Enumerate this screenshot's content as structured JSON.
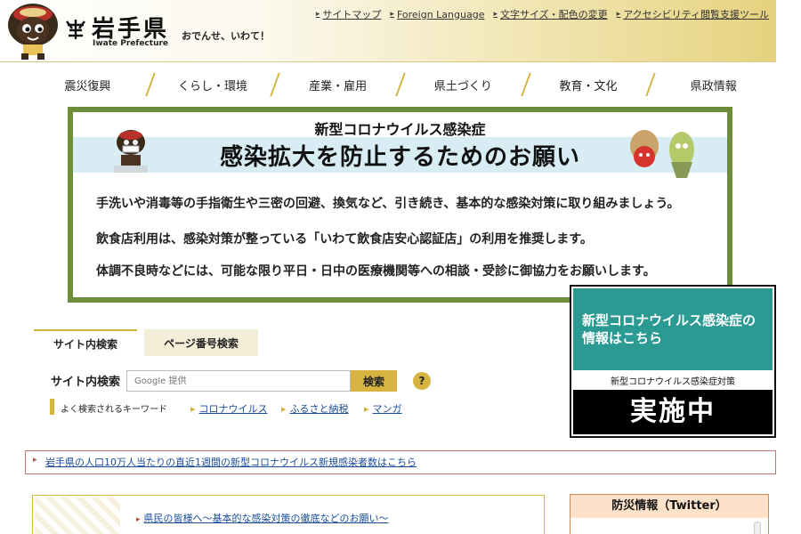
{
  "header": {
    "title": "岩手県",
    "subtitle": "Iwate Prefecture",
    "tagline": "おでんせ、いわて！",
    "links": [
      "サイトマップ",
      "Foreign Language",
      "文字サイズ・配色の変更",
      "アクセシビリティ閲覧支援ツール"
    ]
  },
  "nav": {
    "items": [
      "震災復興",
      "くらし・環境",
      "産業・雇用",
      "県土づくり",
      "教育・文化",
      "県政情報"
    ]
  },
  "banner": {
    "subtitle": "新型コロナウイルス感染症",
    "title": "感染拡大を防止するためのお願い",
    "lines": [
      "手洗いや消毒等の手指衛生や三密の回避、換気など、引き続き、基本的な感染対策に取り組みましょう。",
      "飲食店利用は、感染対策が整っている「いわて飲食店安心認証店」の利用を推奨します。",
      "体調不良時などには、可能な限り平日・日中の医療機関等への相談・受診に御協力をお願いします。"
    ],
    "border_color": "#6e8d3a",
    "band_color": "#d7ecf3"
  },
  "corona_box": {
    "head": "新型コロナウイルス感染症の情報はこちら",
    "label": "新型コロナウイルス感染症対策",
    "foot": "実施中",
    "head_color": "#2a9a93"
  },
  "search": {
    "tabs": [
      "サイト内検索",
      "ページ番号検索"
    ],
    "label": "サイト内検索",
    "placeholder": "Google 提供",
    "button": "検索",
    "help": "?",
    "keywords_title": "よく検索されるキーワード",
    "keywords": [
      "コロナウイルス",
      "ふるさと納税",
      "マンガ"
    ]
  },
  "info_strip": {
    "text": "岩手県の人口10万人当たりの直近1週間の新型コロナウイルス新規感染者数はこちら"
  },
  "news": {
    "items": [
      "県民の皆様へ～基本的な感染対策の徹底などのお願い～"
    ]
  },
  "twitter": {
    "title": "防災情報（Twitter）"
  },
  "colors": {
    "accent_gold": "#d7b43f",
    "link_blue": "#1a4d9c"
  }
}
